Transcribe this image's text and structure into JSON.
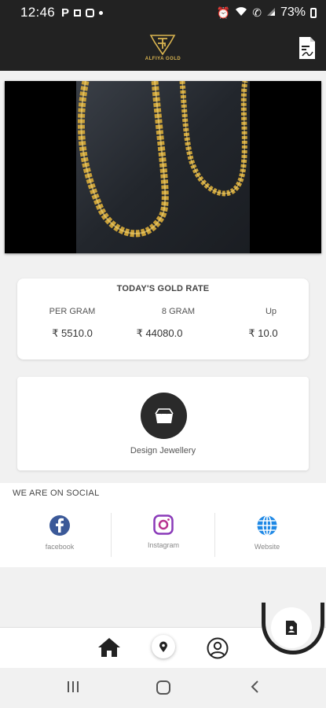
{
  "status_bar": {
    "time": "12:46",
    "left_icons": [
      "p-icon",
      "square-notification-icon",
      "instagram-notification-icon",
      "dot-icon"
    ],
    "right_icons": [
      "alarm-icon",
      "wifi-icon",
      "call-icon",
      "signal-icon"
    ],
    "battery": "73%"
  },
  "app_bar": {
    "logo_text": "ALFIYA GOLD",
    "action_icon": "document-icon"
  },
  "banner": {
    "image": "gold-chain-photo"
  },
  "gold_rate": {
    "title": "TODAY'S GOLD RATE",
    "columns": [
      {
        "label": "PER GRAM",
        "value": "₹ 5510.0"
      },
      {
        "label": "8 GRAM",
        "value": "₹ 44080.0"
      },
      {
        "label": "Up",
        "value": "₹ 10.0"
      }
    ]
  },
  "design": {
    "label": "Design Jewellery",
    "icon": "jewellery-box-icon"
  },
  "social": {
    "title": "WE ARE ON SOCIAL",
    "items": [
      {
        "label": "facebook",
        "icon": "facebook-icon",
        "color": "#3b5998"
      },
      {
        "label": "Instagram",
        "icon": "instagram-icon",
        "color": "#8a3ab9"
      },
      {
        "label": "Website",
        "icon": "globe-icon",
        "color": "#1e88e5"
      }
    ]
  },
  "bottom_nav": {
    "items": [
      "home-icon",
      "location-icon",
      "profile-icon"
    ],
    "fab_icon": "contact-document-icon"
  },
  "system_nav": [
    "recents-icon",
    "home-circle-icon",
    "back-icon"
  ],
  "colors": {
    "dark": "#222222",
    "gold": "#d9b450",
    "background": "#f1f1f1"
  }
}
